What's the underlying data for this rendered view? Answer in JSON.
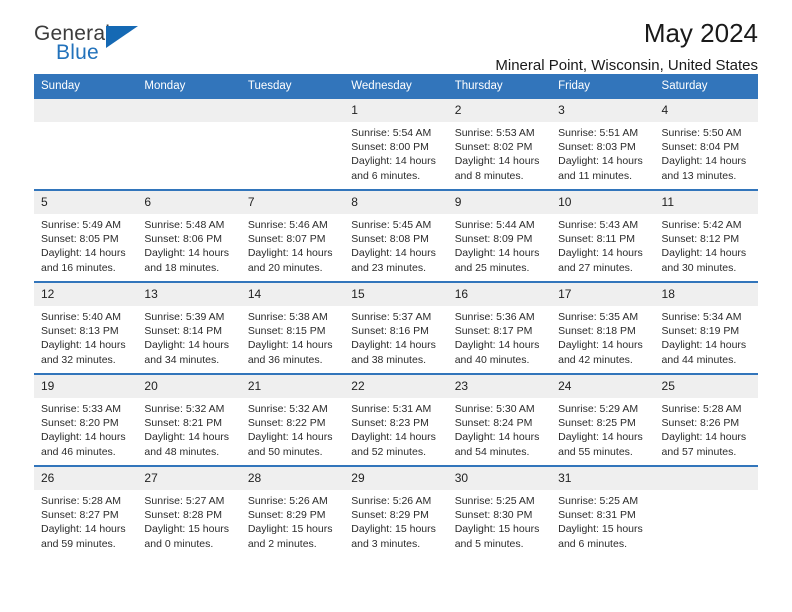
{
  "brand": {
    "line1": "General",
    "line2": "Blue",
    "triangle_icon": "triangle-icon",
    "color_dark": "#3c3c3c",
    "color_blue": "#2272bb"
  },
  "header": {
    "title": "May 2024",
    "location": "Mineral Point, Wisconsin, United States"
  },
  "theme": {
    "header_bg": "#3275bb",
    "header_text": "#ffffff",
    "daynum_bg": "#efefef",
    "cell_bg": "#ffffff"
  },
  "calendar": {
    "weekday_headers": [
      "Sunday",
      "Monday",
      "Tuesday",
      "Wednesday",
      "Thursday",
      "Friday",
      "Saturday"
    ],
    "weeks": [
      [
        {
          "day": "",
          "sunrise": "",
          "sunset": "",
          "daylight": "",
          "empty": true
        },
        {
          "day": "",
          "sunrise": "",
          "sunset": "",
          "daylight": "",
          "empty": true
        },
        {
          "day": "",
          "sunrise": "",
          "sunset": "",
          "daylight": "",
          "empty": true
        },
        {
          "day": "1",
          "sunrise": "Sunrise: 5:54 AM",
          "sunset": "Sunset: 8:00 PM",
          "daylight": "Daylight: 14 hours and 6 minutes.",
          "empty": false
        },
        {
          "day": "2",
          "sunrise": "Sunrise: 5:53 AM",
          "sunset": "Sunset: 8:02 PM",
          "daylight": "Daylight: 14 hours and 8 minutes.",
          "empty": false
        },
        {
          "day": "3",
          "sunrise": "Sunrise: 5:51 AM",
          "sunset": "Sunset: 8:03 PM",
          "daylight": "Daylight: 14 hours and 11 minutes.",
          "empty": false
        },
        {
          "day": "4",
          "sunrise": "Sunrise: 5:50 AM",
          "sunset": "Sunset: 8:04 PM",
          "daylight": "Daylight: 14 hours and 13 minutes.",
          "empty": false
        }
      ],
      [
        {
          "day": "5",
          "sunrise": "Sunrise: 5:49 AM",
          "sunset": "Sunset: 8:05 PM",
          "daylight": "Daylight: 14 hours and 16 minutes.",
          "empty": false
        },
        {
          "day": "6",
          "sunrise": "Sunrise: 5:48 AM",
          "sunset": "Sunset: 8:06 PM",
          "daylight": "Daylight: 14 hours and 18 minutes.",
          "empty": false
        },
        {
          "day": "7",
          "sunrise": "Sunrise: 5:46 AM",
          "sunset": "Sunset: 8:07 PM",
          "daylight": "Daylight: 14 hours and 20 minutes.",
          "empty": false
        },
        {
          "day": "8",
          "sunrise": "Sunrise: 5:45 AM",
          "sunset": "Sunset: 8:08 PM",
          "daylight": "Daylight: 14 hours and 23 minutes.",
          "empty": false
        },
        {
          "day": "9",
          "sunrise": "Sunrise: 5:44 AM",
          "sunset": "Sunset: 8:09 PM",
          "daylight": "Daylight: 14 hours and 25 minutes.",
          "empty": false
        },
        {
          "day": "10",
          "sunrise": "Sunrise: 5:43 AM",
          "sunset": "Sunset: 8:11 PM",
          "daylight": "Daylight: 14 hours and 27 minutes.",
          "empty": false
        },
        {
          "day": "11",
          "sunrise": "Sunrise: 5:42 AM",
          "sunset": "Sunset: 8:12 PM",
          "daylight": "Daylight: 14 hours and 30 minutes.",
          "empty": false
        }
      ],
      [
        {
          "day": "12",
          "sunrise": "Sunrise: 5:40 AM",
          "sunset": "Sunset: 8:13 PM",
          "daylight": "Daylight: 14 hours and 32 minutes.",
          "empty": false
        },
        {
          "day": "13",
          "sunrise": "Sunrise: 5:39 AM",
          "sunset": "Sunset: 8:14 PM",
          "daylight": "Daylight: 14 hours and 34 minutes.",
          "empty": false
        },
        {
          "day": "14",
          "sunrise": "Sunrise: 5:38 AM",
          "sunset": "Sunset: 8:15 PM",
          "daylight": "Daylight: 14 hours and 36 minutes.",
          "empty": false
        },
        {
          "day": "15",
          "sunrise": "Sunrise: 5:37 AM",
          "sunset": "Sunset: 8:16 PM",
          "daylight": "Daylight: 14 hours and 38 minutes.",
          "empty": false
        },
        {
          "day": "16",
          "sunrise": "Sunrise: 5:36 AM",
          "sunset": "Sunset: 8:17 PM",
          "daylight": "Daylight: 14 hours and 40 minutes.",
          "empty": false
        },
        {
          "day": "17",
          "sunrise": "Sunrise: 5:35 AM",
          "sunset": "Sunset: 8:18 PM",
          "daylight": "Daylight: 14 hours and 42 minutes.",
          "empty": false
        },
        {
          "day": "18",
          "sunrise": "Sunrise: 5:34 AM",
          "sunset": "Sunset: 8:19 PM",
          "daylight": "Daylight: 14 hours and 44 minutes.",
          "empty": false
        }
      ],
      [
        {
          "day": "19",
          "sunrise": "Sunrise: 5:33 AM",
          "sunset": "Sunset: 8:20 PM",
          "daylight": "Daylight: 14 hours and 46 minutes.",
          "empty": false
        },
        {
          "day": "20",
          "sunrise": "Sunrise: 5:32 AM",
          "sunset": "Sunset: 8:21 PM",
          "daylight": "Daylight: 14 hours and 48 minutes.",
          "empty": false
        },
        {
          "day": "21",
          "sunrise": "Sunrise: 5:32 AM",
          "sunset": "Sunset: 8:22 PM",
          "daylight": "Daylight: 14 hours and 50 minutes.",
          "empty": false
        },
        {
          "day": "22",
          "sunrise": "Sunrise: 5:31 AM",
          "sunset": "Sunset: 8:23 PM",
          "daylight": "Daylight: 14 hours and 52 minutes.",
          "empty": false
        },
        {
          "day": "23",
          "sunrise": "Sunrise: 5:30 AM",
          "sunset": "Sunset: 8:24 PM",
          "daylight": "Daylight: 14 hours and 54 minutes.",
          "empty": false
        },
        {
          "day": "24",
          "sunrise": "Sunrise: 5:29 AM",
          "sunset": "Sunset: 8:25 PM",
          "daylight": "Daylight: 14 hours and 55 minutes.",
          "empty": false
        },
        {
          "day": "25",
          "sunrise": "Sunrise: 5:28 AM",
          "sunset": "Sunset: 8:26 PM",
          "daylight": "Daylight: 14 hours and 57 minutes.",
          "empty": false
        }
      ],
      [
        {
          "day": "26",
          "sunrise": "Sunrise: 5:28 AM",
          "sunset": "Sunset: 8:27 PM",
          "daylight": "Daylight: 14 hours and 59 minutes.",
          "empty": false
        },
        {
          "day": "27",
          "sunrise": "Sunrise: 5:27 AM",
          "sunset": "Sunset: 8:28 PM",
          "daylight": "Daylight: 15 hours and 0 minutes.",
          "empty": false
        },
        {
          "day": "28",
          "sunrise": "Sunrise: 5:26 AM",
          "sunset": "Sunset: 8:29 PM",
          "daylight": "Daylight: 15 hours and 2 minutes.",
          "empty": false
        },
        {
          "day": "29",
          "sunrise": "Sunrise: 5:26 AM",
          "sunset": "Sunset: 8:29 PM",
          "daylight": "Daylight: 15 hours and 3 minutes.",
          "empty": false
        },
        {
          "day": "30",
          "sunrise": "Sunrise: 5:25 AM",
          "sunset": "Sunset: 8:30 PM",
          "daylight": "Daylight: 15 hours and 5 minutes.",
          "empty": false
        },
        {
          "day": "31",
          "sunrise": "Sunrise: 5:25 AM",
          "sunset": "Sunset: 8:31 PM",
          "daylight": "Daylight: 15 hours and 6 minutes.",
          "empty": false
        },
        {
          "day": "",
          "sunrise": "",
          "sunset": "",
          "daylight": "",
          "empty": true
        }
      ]
    ]
  }
}
